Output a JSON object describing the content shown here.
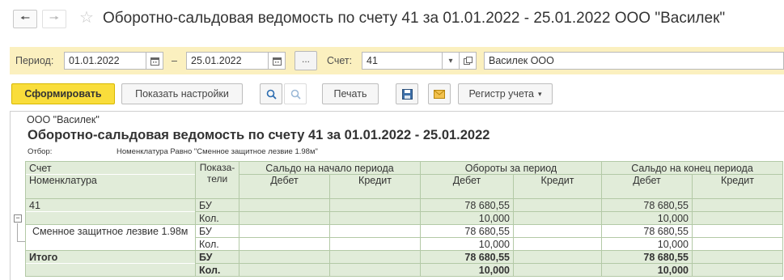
{
  "window": {
    "title": "Оборотно-сальдовая ведомость по счету 41 за 01.01.2022 - 25.01.2022 ООО \"Василек\""
  },
  "filters": {
    "period_label": "Период:",
    "date_from": "01.01.2022",
    "dash": "–",
    "date_to": "25.01.2022",
    "dots": "...",
    "account_label": "Счет:",
    "account_value": "41",
    "org_value": "Василек ООО"
  },
  "toolbar": {
    "generate": "Сформировать",
    "show_settings": "Показать настройки",
    "print": "Печать",
    "register": "Регистр учета"
  },
  "report": {
    "org": "ООО \"Василек\"",
    "title": "Оборотно-сальдовая ведомость по счету 41 за 01.01.2022 - 25.01.2022",
    "selection_label": "Отбор:",
    "selection_value": "Номенклатура Равно \"Сменное защитное лезвие 1.98м\"",
    "headers": {
      "account": "Счет",
      "nomenclature": "Номенклатура",
      "indicators_1": "Показа-",
      "indicators_2": "тели",
      "opening": "Сальдо на начало периода",
      "turnover": "Обороты за период",
      "closing": "Сальдо на конец периода",
      "debit": "Дебет",
      "credit": "Кредит"
    },
    "rows": [
      {
        "name": "41",
        "indicator": "БУ",
        "op_dt": "",
        "op_kt": "",
        "to_dt": "78 680,55",
        "to_kt": "",
        "cl_dt": "78 680,55",
        "cl_kt": ""
      },
      {
        "name": "",
        "indicator": "Кол.",
        "op_dt": "",
        "op_kt": "",
        "to_dt": "10,000",
        "to_kt": "",
        "cl_dt": "10,000",
        "cl_kt": ""
      },
      {
        "name": "Сменное защитное лезвие 1.98м",
        "indicator": "БУ",
        "op_dt": "",
        "op_kt": "",
        "to_dt": "78 680,55",
        "to_kt": "",
        "cl_dt": "78 680,55",
        "cl_kt": ""
      },
      {
        "name": "",
        "indicator": "Кол.",
        "op_dt": "",
        "op_kt": "",
        "to_dt": "10,000",
        "to_kt": "",
        "cl_dt": "10,000",
        "cl_kt": ""
      },
      {
        "name": "Итого",
        "indicator": "БУ",
        "op_dt": "",
        "op_kt": "",
        "to_dt": "78 680,55",
        "to_kt": "",
        "cl_dt": "78 680,55",
        "cl_kt": ""
      },
      {
        "name": "",
        "indicator": "Кол.",
        "op_dt": "",
        "op_kt": "",
        "to_dt": "10,000",
        "to_kt": "",
        "cl_dt": "10,000",
        "cl_kt": ""
      }
    ]
  },
  "colors": {
    "filter_bar": "#fbf0bf",
    "primary_button": "#f9dd3b",
    "grid_header": "#e1ecd9",
    "grid_border": "#b3c9a6"
  }
}
